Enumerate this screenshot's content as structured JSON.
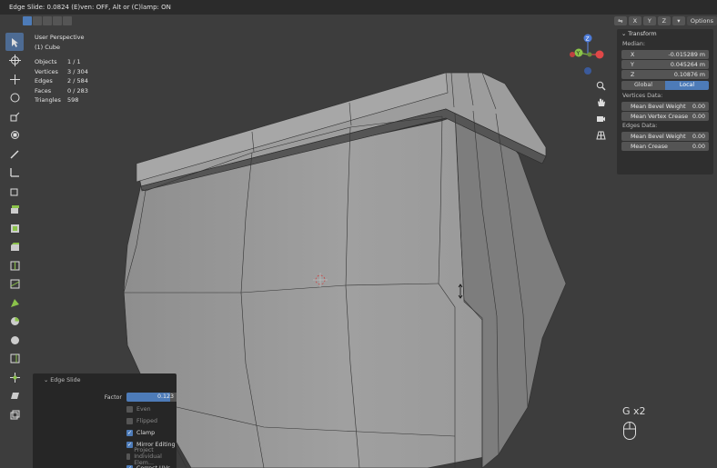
{
  "header": {
    "status": "Edge Slide: 0.0824 (E)ven: OFF, Alt or (C)lamp: ON"
  },
  "overlay": {
    "view": "User Perspective",
    "object": "(1) Cube",
    "stats": [
      {
        "label": "Objects",
        "value": "1 / 1"
      },
      {
        "label": "Vertices",
        "value": "3 / 304"
      },
      {
        "label": "Edges",
        "value": "2 / 584"
      },
      {
        "label": "Faces",
        "value": "0 / 283"
      },
      {
        "label": "Triangles",
        "value": "598"
      }
    ]
  },
  "right_header": {
    "axes": [
      "X",
      "Y",
      "Z"
    ],
    "options": "Options"
  },
  "transform": {
    "title": "Transform",
    "median_label": "Median:",
    "x": {
      "axis": "X",
      "value": "-0.015289 m"
    },
    "y": {
      "axis": "Y",
      "value": "0.045264 m"
    },
    "z": {
      "axis": "Z",
      "value": "0.10876 m"
    },
    "global": "Global",
    "local": "Local",
    "vertices_label": "Vertices Data:",
    "mean_bevel_weight_v": {
      "label": "Mean Bevel Weight",
      "value": "0.00"
    },
    "mean_vertex_crease": {
      "label": "Mean Vertex Crease",
      "value": "0.00"
    },
    "edges_label": "Edges Data:",
    "mean_bevel_weight_e": {
      "label": "Mean Bevel Weight",
      "value": "0.00"
    },
    "mean_crease": {
      "label": "Mean Crease",
      "value": "0.00"
    }
  },
  "gizmo": {
    "z": "Z",
    "y": "Y",
    "x": "X"
  },
  "operator": {
    "title": "Edge Slide",
    "factor_label": "Factor",
    "factor_value": "0.123",
    "factor_fraction": 0.56,
    "options": [
      {
        "label": "Even",
        "checked": false
      },
      {
        "label": "Flipped",
        "checked": false
      },
      {
        "label": "Clamp",
        "checked": true
      },
      {
        "label": "Mirror Editing",
        "checked": true
      },
      {
        "label": "Project Individual Elem...",
        "checked": false
      },
      {
        "label": "Correct UVs",
        "checked": true
      }
    ]
  },
  "keys": {
    "shortcut": "G x2"
  },
  "colors": {
    "accent": "#4d7bb8",
    "panel": "#2f2f2f",
    "background": "#3d3d3d"
  }
}
